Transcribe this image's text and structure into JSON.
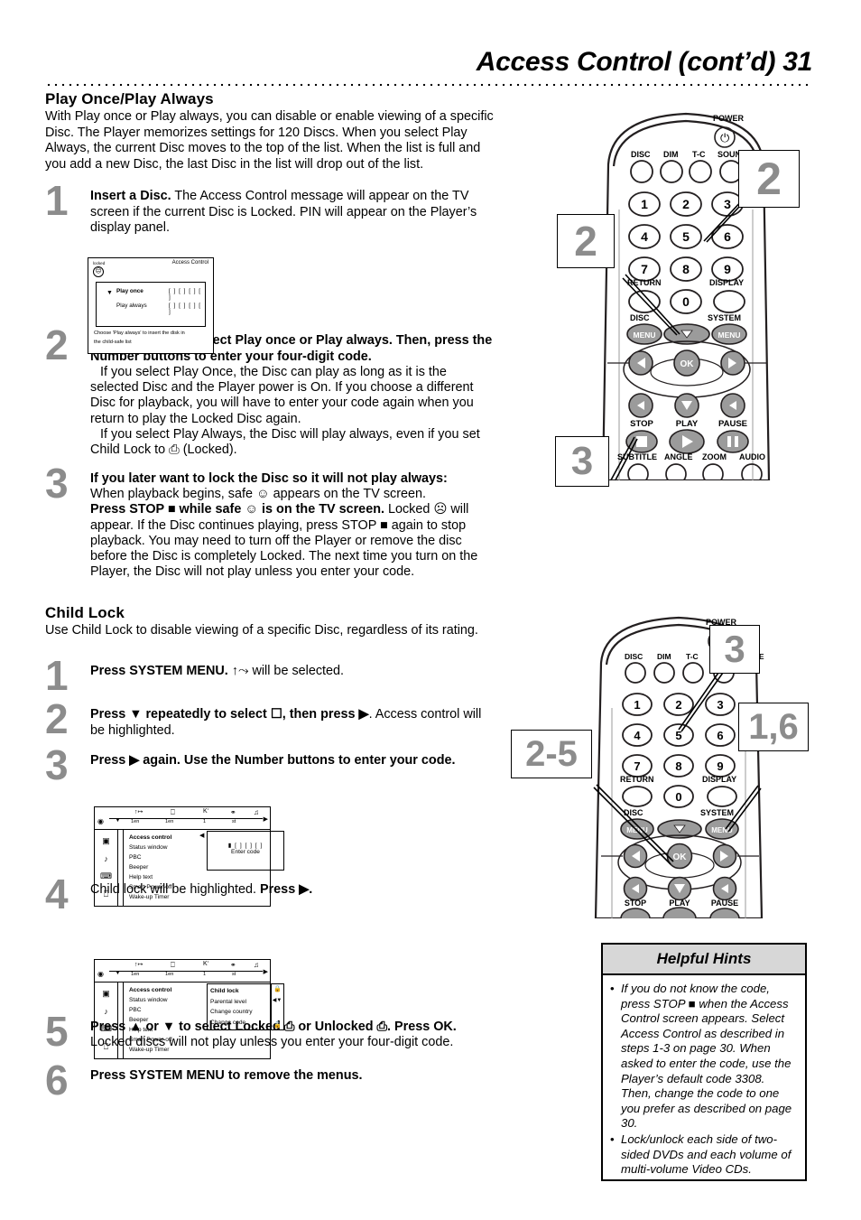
{
  "header": {
    "title": "Access Control (cont’d)  31"
  },
  "sections": {
    "play": {
      "heading": "Play Once/Play Always",
      "intro": "With Play once or Play always, you can disable or enable viewing of a specific Disc. The Player memorizes settings for 120 Discs. When you select Play Always, the current Disc moves to the top of the list. When the list is full and you add a new Disc, the last Disc in the list will drop out of the list.",
      "steps": [
        {
          "num": "1",
          "bold": "Insert a Disc.",
          "rest": " The Access Control message will appear on the TV screen if the current Disc is Locked. PIN will appear on the Player’s display panel."
        },
        {
          "num": "2",
          "bold": "Press ▲ or ▼ to select Play once or Play always. Then, press the Number buttons to enter your four-digit code.",
          "p1": "If you select Play Once, the Disc can play as long as it is the selected Disc and the Player power is On. If you choose a different Disc for playback, you will have to enter your code again when you return to play the Locked Disc again.",
          "p2": "If you select Play Always, the Disc will play always, even if you set Child Lock to ⎙ (Locked)."
        },
        {
          "num": "3",
          "bold": "If you later want to lock the Disc so it will not play always:",
          "p1": "When playback begins, safe ☺  appears on the TV screen.",
          "bold2": "Press STOP ■ while safe ☺ is on the TV screen.",
          "p2": " Locked ☹ will appear. If the Disc continues playing, press STOP ■ again to stop playback. You may need to turn off the Player or remove the disc before the Disc is completely Locked. The next time you turn on the Player, the Disc will not play unless you enter your code."
        }
      ]
    },
    "childlock": {
      "heading": "Child Lock",
      "intro": "Use Child Lock to disable viewing of a specific Disc, regardless of its rating.",
      "steps": [
        {
          "num": "1",
          "bold": "Press SYSTEM MENU.",
          "rest": " ↑⤳ will be selected."
        },
        {
          "num": "2",
          "bold": "Press ▼ repeatedly to select ☐, then press ▶",
          "rest": ". Access control will be highlighted."
        },
        {
          "num": "3",
          "bold": "Press ▶ again. Use the Number buttons to enter your code.",
          "rest": ""
        },
        {
          "num": "4",
          "plain": "Child lock will be highlighted. ",
          "bold": "Press ▶.",
          "rest": ""
        },
        {
          "num": "5",
          "bold": "Press ▲ or ▼ to select Locked ⎙ or Unlocked ⎙. Press OK.",
          "rest": "",
          "p1": "Locked discs will not play unless you enter your four-digit code."
        },
        {
          "num": "6",
          "bold": "Press SYSTEM MENU to remove the menus.",
          "rest": ""
        }
      ]
    }
  },
  "tv_screen": {
    "locked_label": "locked",
    "title": "Access Control",
    "rows": [
      {
        "label": "Play once",
        "selected": true,
        "code": "[ ] [ ] [ ] [ ]"
      },
      {
        "label": "Play always",
        "selected": false,
        "code": "[ ] [ ] [ ] [ ]"
      }
    ],
    "footer_line1": "Choose 'Play always' to insert the disk in",
    "footer_line2": "the child-safe list"
  },
  "osd_menu_step3": {
    "bar_values": [
      "1en",
      "1en",
      "1",
      "st"
    ],
    "items": [
      "Access control",
      "Status window",
      "PBC",
      "Beeper",
      "Help text",
      "Smart Power-off",
      "Wake-up Timer"
    ],
    "selected_item": "Access control",
    "code_dots": "[ ] [ ] [ ]",
    "code_label": "Enter code"
  },
  "osd_menu_step4": {
    "bar_values": [
      "1en",
      "1en",
      "1",
      "st"
    ],
    "items": [
      "Access control",
      "Status window",
      "PBC",
      "Beeper",
      "Help text",
      "Smart Power-off",
      "Wake-up Timer"
    ],
    "selected_item": "Access control",
    "sub_items": [
      "Child lock",
      "Parental level",
      "Change country",
      "Change code"
    ],
    "sub_selected": "Child lock"
  },
  "remote_top": {
    "power_label": "POWER",
    "top_row": [
      "DISC",
      "DIM",
      "T-C",
      "SOUND MODE"
    ],
    "keypad": [
      "1",
      "2",
      "3",
      "4",
      "5",
      "6",
      "7",
      "8",
      "9",
      "0"
    ],
    "return_label": "RETURN",
    "display_label": "DISPLAY",
    "disc_menu_label": "DISC",
    "system_menu_label": "SYSTEM",
    "menu_button": "MENU",
    "ok_button": "OK",
    "transport": [
      "STOP",
      "PLAY",
      "PAUSE"
    ],
    "bottom_row": [
      "SUBTITLE",
      "ANGLE",
      "ZOOM",
      "AUDIO"
    ],
    "callouts": [
      {
        "label": "2",
        "target": "keypad"
      },
      {
        "label": "2",
        "target": "up-arrow"
      },
      {
        "label": "3",
        "target": "stop-button"
      }
    ]
  },
  "remote_bottom": {
    "power_label": "POWER",
    "top_row": [
      "DISC",
      "DIM",
      "T-C",
      "SOUND MODE"
    ],
    "keypad": [
      "1",
      "2",
      "3",
      "4",
      "5",
      "6",
      "7",
      "8",
      "9",
      "0"
    ],
    "return_label": "RETURN",
    "display_label": "DISPLAY",
    "disc_menu_label": "DISC",
    "system_menu_label": "SYSTEM",
    "menu_button": "MENU",
    "ok_button": "OK",
    "transport": [
      "STOP",
      "PLAY",
      "PAUSE"
    ],
    "callouts": [
      {
        "label": "3",
        "target": "keypad"
      },
      {
        "label": "1,6",
        "target": "system-menu-button"
      },
      {
        "label": "2-5",
        "target": "ok-navigation-pad"
      }
    ]
  },
  "hints": {
    "title": "Helpful Hints",
    "items": [
      "If you do not know the code, press STOP ■ when the Access Control screen appears. Select Access Control as described in steps 1-3 on page 30. When asked to enter the code, use the Player’s default code 3308. Then, change the code to one you prefer as described on page 30.",
      "Lock/unlock each side of two-sided DVDs and each volume of multi-volume Video CDs."
    ]
  },
  "colors": {
    "step_number_gray": "#8c8c8c",
    "hints_header_gray": "#d7d7d7",
    "button_gray": "#9b9b9b"
  }
}
